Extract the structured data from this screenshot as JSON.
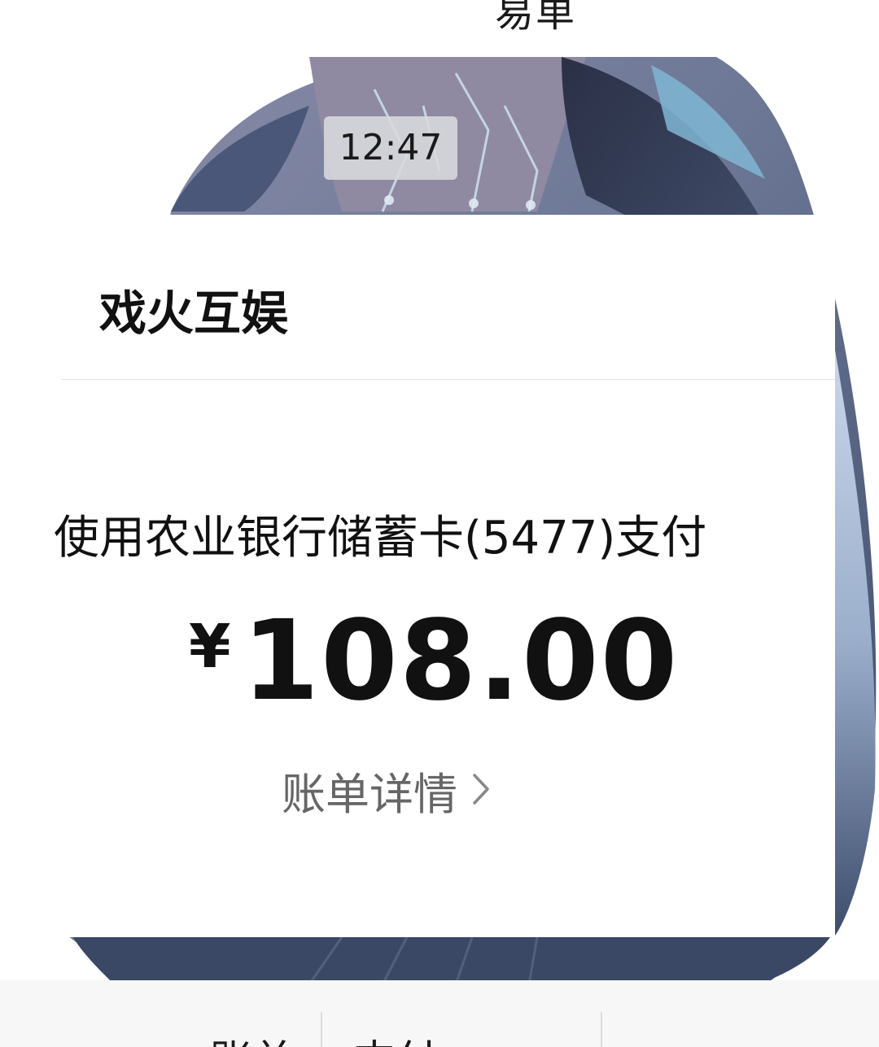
{
  "header": {
    "title_fragment": "易单"
  },
  "chat": {
    "timestamp": "12:47"
  },
  "payment_card": {
    "merchant_name": "戏火互娱",
    "payment_method": "使用农业银行储蓄卡(5477)支付",
    "currency_symbol": "¥",
    "amount": "108.00",
    "detail_link_label": "账单详情"
  },
  "bottom_menu": {
    "items": [
      {
        "label": "账单"
      },
      {
        "label": "支付"
      }
    ]
  },
  "colors": {
    "card_background": "#ffffff",
    "primary_text": "#111111",
    "secondary_text": "#666666",
    "timestamp_chip": "#dadade"
  },
  "icons": {
    "detail_chevron": "chevron-right-icon"
  }
}
